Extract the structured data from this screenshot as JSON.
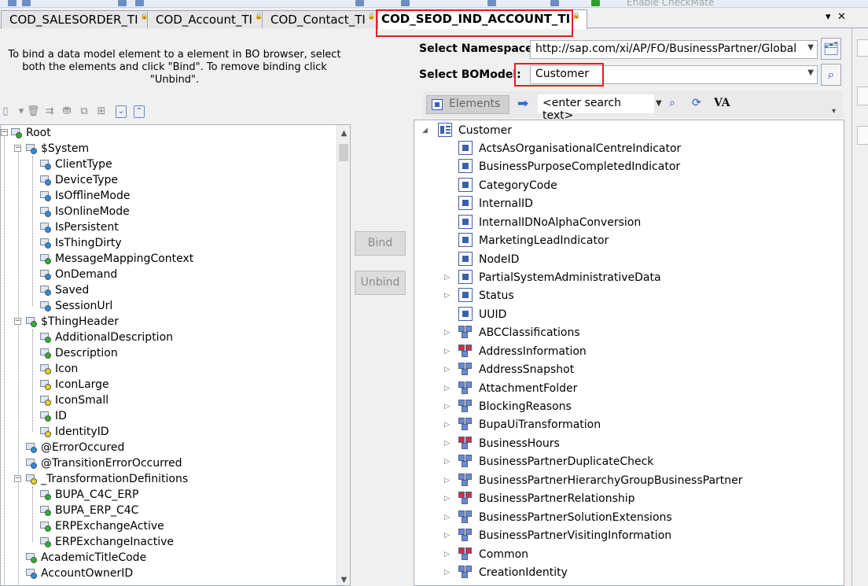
{
  "top_toolbar": {
    "checkmate_label": "Enable CheckMate"
  },
  "tabs": [
    {
      "label": "COD_SALESORDER_TI"
    },
    {
      "label": "COD_Account_TI"
    },
    {
      "label": "COD_Contact_TI"
    },
    {
      "label": "COD_SEOD_IND_ACCOUNT_TI"
    }
  ],
  "tab_controls": {
    "menu": "▾",
    "close": "✕"
  },
  "left": {
    "instructions": "To bind a data model element to a element in BO browser, select both the elements and click \"Bind\". To remove binding click \"Unbind\".",
    "tree": [
      {
        "label": "Root"
      },
      {
        "label": "$System"
      },
      {
        "label": "ClientType"
      },
      {
        "label": "DeviceType"
      },
      {
        "label": "IsOfflineMode"
      },
      {
        "label": "IsOnlineMode"
      },
      {
        "label": "IsPersistent"
      },
      {
        "label": "IsThingDirty"
      },
      {
        "label": "MessageMappingContext"
      },
      {
        "label": "OnDemand"
      },
      {
        "label": "Saved"
      },
      {
        "label": "SessionUrl"
      },
      {
        "label": "$ThingHeader"
      },
      {
        "label": "AdditionalDescription"
      },
      {
        "label": "Description"
      },
      {
        "label": "Icon"
      },
      {
        "label": "IconLarge"
      },
      {
        "label": "IconSmall"
      },
      {
        "label": "ID"
      },
      {
        "label": "IdentityID"
      },
      {
        "label": "@ErrorOccured"
      },
      {
        "label": "@TransitionErrorOccurred"
      },
      {
        "label": "_TransformationDefinitions"
      },
      {
        "label": "BUPA_C4C_ERP"
      },
      {
        "label": "BUPA_ERP_C4C"
      },
      {
        "label": "ERPExchangeActive"
      },
      {
        "label": "ERPExchangeInactive"
      },
      {
        "label": "AcademicTitleCode"
      },
      {
        "label": "AccountOwnerID"
      }
    ]
  },
  "middle": {
    "bind_label": "Bind",
    "unbind_label": "Unbind"
  },
  "right": {
    "namespace_label": "Select Namespace:",
    "namespace_value": "http://sap.com/xi/AP/FO/BusinessPartner/Global",
    "bomodel_label": "Select BOModel:",
    "bomodel_value": "Customer",
    "elements_label": "Elements",
    "search_placeholder": "<enter search text>",
    "va_label": "VA",
    "tree_root": "Customer",
    "tree": [
      {
        "label": "ActsAsOrganisationalCentreIndicator"
      },
      {
        "label": "BusinessPurposeCompletedIndicator"
      },
      {
        "label": "CategoryCode"
      },
      {
        "label": "InternalID"
      },
      {
        "label": "InternalIDNoAlphaConversion"
      },
      {
        "label": "MarketingLeadIndicator"
      },
      {
        "label": "NodeID"
      },
      {
        "label": "PartialSystemAdministrativeData"
      },
      {
        "label": "Status"
      },
      {
        "label": "UUID"
      },
      {
        "label": "ABCClassifications"
      },
      {
        "label": "AddressInformation"
      },
      {
        "label": "AddressSnapshot"
      },
      {
        "label": "AttachmentFolder"
      },
      {
        "label": "BlockingReasons"
      },
      {
        "label": "BupaUiTransformation"
      },
      {
        "label": "BusinessHours"
      },
      {
        "label": "BusinessPartnerDuplicateCheck"
      },
      {
        "label": "BusinessPartnerHierarchyGroupBusinessPartner"
      },
      {
        "label": "BusinessPartnerRelationship"
      },
      {
        "label": "BusinessPartnerSolutionExtensions"
      },
      {
        "label": "BusinessPartnerVisitingInformation"
      },
      {
        "label": "Common"
      },
      {
        "label": "CreationIdentity"
      }
    ]
  }
}
